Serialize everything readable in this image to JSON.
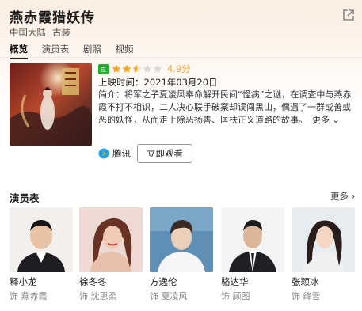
{
  "title": "燕赤霞猎妖传",
  "meta": {
    "region": "中国大陆",
    "genre": "古装"
  },
  "tabs": [
    "概览",
    "演员表",
    "剧照",
    "视频"
  ],
  "active_tab": "概览",
  "rating": {
    "badge": "豆",
    "stars": 2.5,
    "max_stars": 5,
    "score_text": "4.9分"
  },
  "release": "上映时间：2021年03月20日",
  "intro": "简介：将军之子夏凌风奉命解开民间“怪病”之谜，在调查中与燕赤霞不打不相识，二人决心联手破案却误闯黑山，偶遇了一群或善或恶的妖怪，从而走上除恶扬善、匡扶正义道路的故事。",
  "intro_more": "更多",
  "platform": {
    "name": "腾讯",
    "icon": "tencent-video-icon"
  },
  "watch_label": "立即观看",
  "cast_section": {
    "title": "演员表",
    "more": "更多"
  },
  "cast": [
    {
      "name": "释小龙",
      "role": "饰 燕赤霞"
    },
    {
      "name": "徐冬冬",
      "role": "饰 沈思柔"
    },
    {
      "name": "方逸伦",
      "role": "饰 夏凌风"
    },
    {
      "name": "骆达华",
      "role": "饰 顾图"
    },
    {
      "name": "张颖冰",
      "role": "饰 绛雪"
    }
  ],
  "colors": {
    "accent": "#f5a623",
    "badge_green": "#20b32a",
    "header_tint": "#fbeee2"
  }
}
